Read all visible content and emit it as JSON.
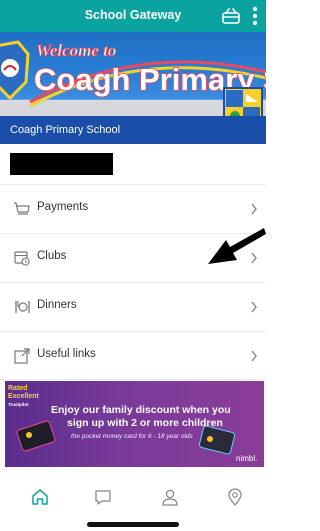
{
  "appbar": {
    "title": "School Gateway"
  },
  "banner": {
    "welcome_text": "Welcome to",
    "school_art_text": "Coagh Primary Sch",
    "school_name": "Coagh Primary School"
  },
  "menu": {
    "items": [
      {
        "label": "Payments",
        "icon": "basket-icon"
      },
      {
        "label": "Clubs",
        "icon": "calendar-clock-icon"
      },
      {
        "label": "Dinners",
        "icon": "cutlery-icon"
      },
      {
        "label": "Useful links",
        "icon": "external-link-icon"
      }
    ]
  },
  "ad": {
    "rated_line1": "Rated",
    "rated_line2": "Excellent",
    "rated_line3": "Trustpilot",
    "headline_1": "Enjoy our family discount when you",
    "headline_2": "sign up with 2 or more children",
    "subline": "the pocket money card for 6 - 18 year olds",
    "brand": "nimbl."
  },
  "tabbar": {
    "tabs": [
      {
        "icon": "home-icon",
        "active": true
      },
      {
        "icon": "chat-icon",
        "active": false
      },
      {
        "icon": "person-icon",
        "active": false
      },
      {
        "icon": "location-pin-icon",
        "active": false
      }
    ]
  },
  "colors": {
    "accent": "#0ba3a0",
    "banner_strip": "#1a4ea8",
    "ad_purple": "#5a2d8c"
  }
}
